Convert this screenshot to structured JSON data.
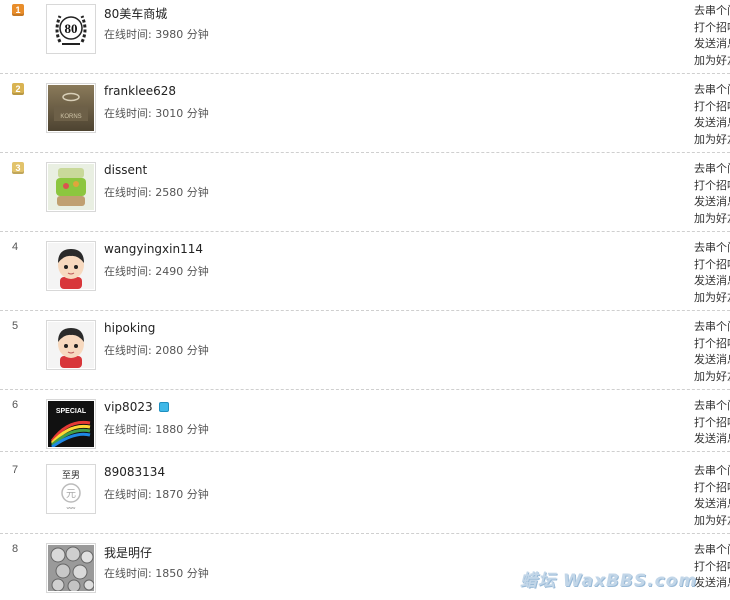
{
  "colors": {
    "gold": "#e88d2b",
    "silver": "#d9b352",
    "bronze": "#e2c36b",
    "vip": "#3fb8e8"
  },
  "actions": [
    "去串个门",
    "打个招呼",
    "发送消息",
    "加为好友"
  ],
  "online_label": "在线时间:",
  "members": [
    {
      "rank": "1",
      "badge": "gold",
      "name": "80美车商城",
      "online_minutes": "3980",
      "unit": "分钟",
      "avatar_icon": "laurel-80-avatar-icon"
    },
    {
      "rank": "2",
      "badge": "silver",
      "name": "franklee628",
      "online_minutes": "3010",
      "unit": "分钟",
      "avatar_icon": "car-emblem-avatar-icon"
    },
    {
      "rank": "3",
      "badge": "bronze",
      "name": "dissent",
      "online_minutes": "2580",
      "unit": "分钟",
      "avatar_icon": "green-object-avatar-icon"
    },
    {
      "rank": "4",
      "badge": "",
      "name": "wangyingxin114",
      "online_minutes": "2490",
      "unit": "分钟",
      "avatar_icon": "cartoon-boy-avatar-icon"
    },
    {
      "rank": "5",
      "badge": "",
      "name": "hipoking",
      "online_minutes": "2080",
      "unit": "分钟",
      "avatar_icon": "cartoon-boy-avatar-icon"
    },
    {
      "rank": "6",
      "badge": "",
      "name": "vip8023",
      "online_minutes": "1880",
      "unit": "分钟",
      "avatar_icon": "special-stage-avatar-icon"
    },
    {
      "rank": "7",
      "badge": "",
      "name": "89083134",
      "online_minutes": "1870",
      "unit": "分钟",
      "avatar_icon": "yuan-logo-avatar-icon"
    },
    {
      "rank": "8",
      "badge": "",
      "name": "我是明仔",
      "online_minutes": "1850",
      "unit": "分钟",
      "avatar_icon": "metal-balls-avatar-icon"
    }
  ],
  "watermark": "蜡坛 WaxBBS.com"
}
